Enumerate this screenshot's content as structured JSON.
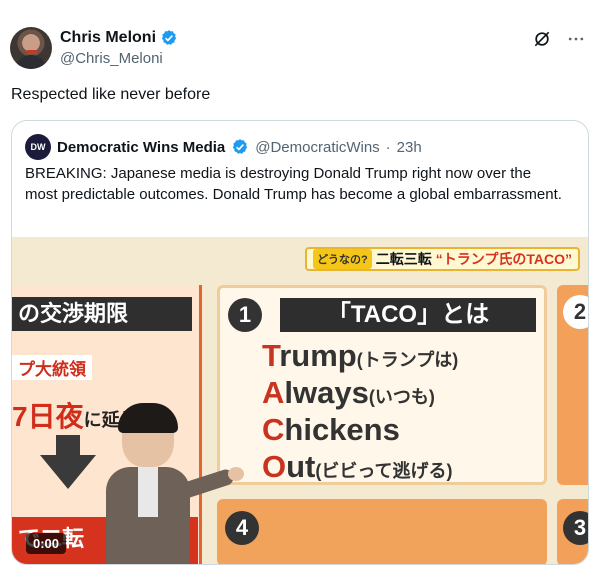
{
  "author": {
    "name": "Chris Meloni",
    "handle": "@Chris_Meloni",
    "verified": true
  },
  "tweet": {
    "text": "Respected like never before"
  },
  "actions": {
    "grok_icon": "slash-circle-icon",
    "more_icon": "more-icon"
  },
  "quote": {
    "logo_text": "DW",
    "name": "Democratic Wins Media",
    "handle": "@DemocraticWins",
    "separator": "·",
    "time": "23h",
    "text": "BREAKING: Japanese media is destroying Donald Trump right now over the most predictable outcomes. Donald Trump has become a global embarrassment."
  },
  "video": {
    "timestamp": "0:00",
    "banner_tag": "どうなの?",
    "banner_text": "二転三転",
    "banner_highlight": "“トランプ氏のTACO”",
    "left_title": "の交渉期限",
    "left_sub": "プ大統領",
    "left_date": "7日夜",
    "left_date_suffix": "に延長",
    "left_bottom": "で二転",
    "card_number": "1",
    "card_title": "「TACO」とは",
    "taco_lines": [
      {
        "first": "T",
        "rest": "rump",
        "jp": "(トランプは)"
      },
      {
        "first": "A",
        "rest": "lways",
        "jp": "(いつも)"
      },
      {
        "first": "C",
        "rest": "hickens",
        "jp": ""
      },
      {
        "first": "O",
        "rest": "ut",
        "jp": "(ビビって逃げる)"
      }
    ],
    "card2_number": "4",
    "right_number": "2",
    "right_number2": "3"
  },
  "colors": {
    "verified_blue": "#1d9bf0",
    "text_primary": "#0f1419",
    "text_secondary": "#536471",
    "border": "#cfd9de",
    "accent_red": "#c8341f"
  }
}
